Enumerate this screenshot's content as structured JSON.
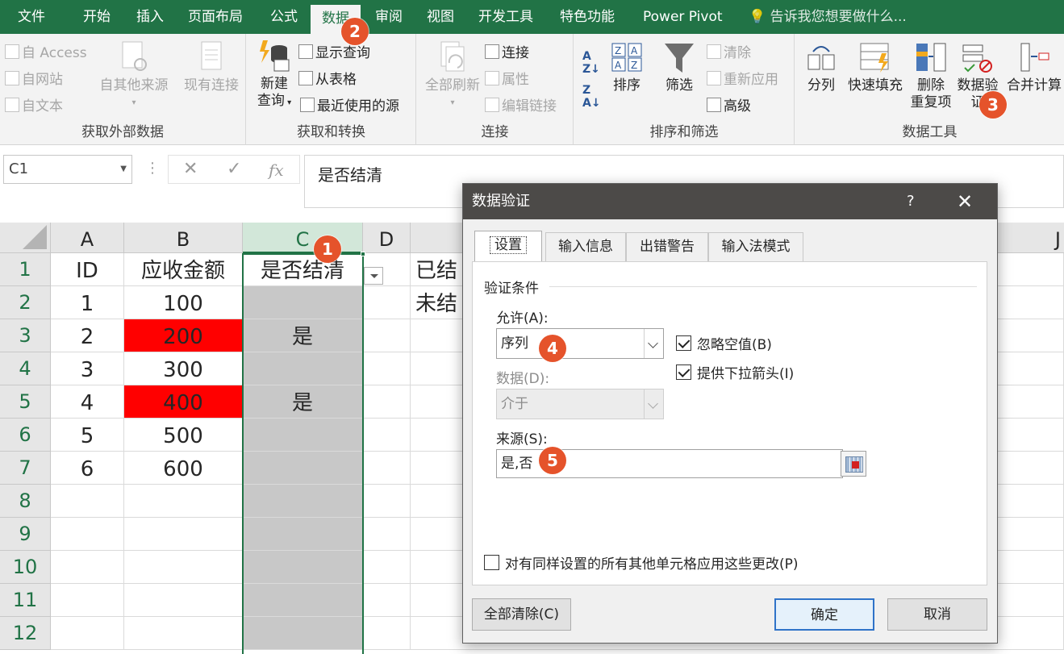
{
  "ribbon_tabs": [
    "文件",
    "开始",
    "插入",
    "页面布局",
    "公式",
    "数据",
    "审阅",
    "视图",
    "开发工具",
    "特色功能",
    "Power Pivot"
  ],
  "tell_me": "告诉我您想要做什么...",
  "groups": {
    "external": {
      "label": "获取外部数据",
      "access": "自 Access",
      "web": "自网站",
      "text": "自文本",
      "other_sources": "自其他来源",
      "existing": "现有连接"
    },
    "transform": {
      "label": "获取和转换",
      "new_query_1": "新建",
      "new_query_2": "查询",
      "show_queries": "显示查询",
      "from_table": "从表格",
      "recent_sources": "最近使用的源"
    },
    "connections": {
      "label": "连接",
      "refresh_all": "全部刷新",
      "connections": "连接",
      "properties": "属性",
      "edit_links": "编辑链接"
    },
    "sortfilter": {
      "label": "排序和筛选",
      "sort": "排序",
      "filter": "筛选",
      "clear": "清除",
      "reapply": "重新应用",
      "advanced": "高级"
    },
    "datatools": {
      "label": "数据工具",
      "text_to_columns": "分列",
      "flash_fill": "快速填充",
      "remove_dup_1": "删除",
      "remove_dup_2": "重复项",
      "validation_1": "数据验",
      "validation_2": "证",
      "consolidate": "合并计算"
    }
  },
  "formula_bar": {
    "name_box": "C1",
    "fx": "fx",
    "cancel": "✕",
    "enter": "✓",
    "content": "是否结清"
  },
  "grid": {
    "columns": [
      "A",
      "B",
      "C",
      "D",
      "J"
    ],
    "row_numbers": [
      "1",
      "2",
      "3",
      "4",
      "5",
      "6",
      "7",
      "8",
      "9",
      "10",
      "11",
      "12"
    ],
    "header_row": [
      "ID",
      "应收金额",
      "是否结清"
    ],
    "rows": [
      {
        "id": "1",
        "amount": "100",
        "settled": ""
      },
      {
        "id": "2",
        "amount": "200",
        "settled": "是"
      },
      {
        "id": "3",
        "amount": "300",
        "settled": ""
      },
      {
        "id": "4",
        "amount": "400",
        "settled": "是"
      },
      {
        "id": "5",
        "amount": "500",
        "settled": ""
      },
      {
        "id": "6",
        "amount": "600",
        "settled": ""
      }
    ],
    "side_labels": [
      "已结",
      "未结"
    ],
    "highlight_color": "#ff0000"
  },
  "dialog": {
    "title": "数据验证",
    "help": "?",
    "close": "✕",
    "tabs": [
      "设置",
      "输入信息",
      "出错警告",
      "输入法模式"
    ],
    "section": "验证条件",
    "allow_label": "允许(A):",
    "allow_value": "序列",
    "data_label": "数据(D):",
    "data_value": "介于",
    "ignore_blank": "忽略空值(B)",
    "in_cell_dropdown": "提供下拉箭头(I)",
    "source_label": "来源(S):",
    "source_value": "是,否",
    "apply_all": "对有同样设置的所有其他单元格应用这些更改(P)",
    "clear_all": "全部清除(C)",
    "ok": "确定",
    "cancel": "取消"
  },
  "badges": [
    "1",
    "2",
    "3",
    "4",
    "5"
  ],
  "colors": {
    "excel_green": "#217346",
    "badge": "#e5532b"
  }
}
